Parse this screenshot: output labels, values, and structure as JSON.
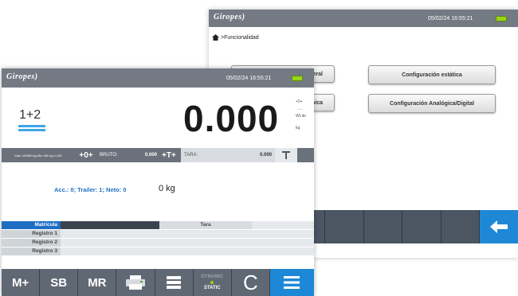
{
  "back_screen": {
    "logo": "Giropes)",
    "datetime": "05/02/24 16:55:21",
    "breadcrumb": ">Funcionalidad",
    "buttons": [
      "eral",
      "Configuración estática",
      "mica",
      "Configuración Analógica/Digital"
    ]
  },
  "front_screen": {
    "logo": "Giropes)",
    "datetime": "05/02/24 16:55:21",
    "scale_mode": "1+2",
    "weight": "0.000",
    "unit": "kg",
    "side_indicators": [
      "+0+",
      "→←",
      "Wt.de"
    ],
    "capacity": "Max 120000 kg Min 400 kg e 100",
    "zero_icon": "+0+",
    "bruto_label": "BRUTO:",
    "bruto_value": "0.000",
    "tare_icon": "+T+",
    "tara_label": "TARA:",
    "tara_value": "0.000",
    "accum_text": "Acc.: 0; Trailer: 1; Neto: 0",
    "accum_weight": "0 kg",
    "table": {
      "headers": [
        "Matrícula",
        "",
        "Tara"
      ],
      "rows": [
        "Registro 1",
        "Registro 2",
        "Registro 3"
      ]
    },
    "keys": [
      "M+",
      "SB",
      "MR",
      "",
      "",
      "DYNAMIC",
      "STATIC",
      "C",
      ""
    ]
  },
  "colors": {
    "accent_blue": "#1e88d6",
    "battery": "#9bd21a",
    "bar": "#737a83"
  }
}
